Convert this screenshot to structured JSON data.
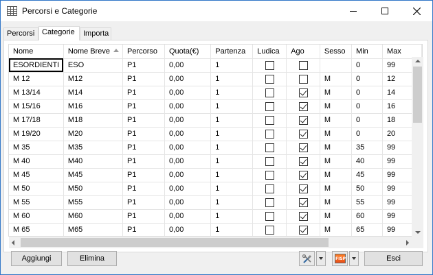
{
  "window": {
    "title": "Percorsi e Categorie"
  },
  "tabs": [
    {
      "label": "Percorsi"
    },
    {
      "label": "Categorie"
    },
    {
      "label": "Importa"
    }
  ],
  "grid": {
    "columns": [
      "Nome",
      "Nome Breve",
      "Percorso",
      "Quota(€)",
      "Partenza",
      "Ludica",
      "Ago",
      "Sesso",
      "Min",
      "Max"
    ],
    "sorted_column": "Nome Breve",
    "rows": [
      {
        "nome": "ESORDIENTI",
        "breve": "ESO",
        "percorso": "P1",
        "quota": "0,00",
        "partenza": "1",
        "ludica": false,
        "ago": false,
        "sesso": "",
        "min": "0",
        "max": "99"
      },
      {
        "nome": "M 12",
        "breve": "M12",
        "percorso": "P1",
        "quota": "0,00",
        "partenza": "1",
        "ludica": false,
        "ago": false,
        "sesso": "M",
        "min": "0",
        "max": "12"
      },
      {
        "nome": "M 13/14",
        "breve": "M14",
        "percorso": "P1",
        "quota": "0,00",
        "partenza": "1",
        "ludica": false,
        "ago": true,
        "sesso": "M",
        "min": "0",
        "max": "14"
      },
      {
        "nome": "M 15/16",
        "breve": "M16",
        "percorso": "P1",
        "quota": "0,00",
        "partenza": "1",
        "ludica": false,
        "ago": true,
        "sesso": "M",
        "min": "0",
        "max": "16"
      },
      {
        "nome": "M 17/18",
        "breve": "M18",
        "percorso": "P1",
        "quota": "0,00",
        "partenza": "1",
        "ludica": false,
        "ago": true,
        "sesso": "M",
        "min": "0",
        "max": "18"
      },
      {
        "nome": "M 19/20",
        "breve": "M20",
        "percorso": "P1",
        "quota": "0,00",
        "partenza": "1",
        "ludica": false,
        "ago": true,
        "sesso": "M",
        "min": "0",
        "max": "20"
      },
      {
        "nome": "M 35",
        "breve": "M35",
        "percorso": "P1",
        "quota": "0,00",
        "partenza": "1",
        "ludica": false,
        "ago": true,
        "sesso": "M",
        "min": "35",
        "max": "99"
      },
      {
        "nome": "M 40",
        "breve": "M40",
        "percorso": "P1",
        "quota": "0,00",
        "partenza": "1",
        "ludica": false,
        "ago": true,
        "sesso": "M",
        "min": "40",
        "max": "99"
      },
      {
        "nome": "M 45",
        "breve": "M45",
        "percorso": "P1",
        "quota": "0,00",
        "partenza": "1",
        "ludica": false,
        "ago": true,
        "sesso": "M",
        "min": "45",
        "max": "99"
      },
      {
        "nome": "M 50",
        "breve": "M50",
        "percorso": "P1",
        "quota": "0,00",
        "partenza": "1",
        "ludica": false,
        "ago": true,
        "sesso": "M",
        "min": "50",
        "max": "99"
      },
      {
        "nome": "M 55",
        "breve": "M55",
        "percorso": "P1",
        "quota": "0,00",
        "partenza": "1",
        "ludica": false,
        "ago": true,
        "sesso": "M",
        "min": "55",
        "max": "99"
      },
      {
        "nome": "M 60",
        "breve": "M60",
        "percorso": "P1",
        "quota": "0,00",
        "partenza": "1",
        "ludica": false,
        "ago": true,
        "sesso": "M",
        "min": "60",
        "max": "99"
      },
      {
        "nome": "M 65",
        "breve": "M65",
        "percorso": "P1",
        "quota": "0,00",
        "partenza": "1",
        "ludica": false,
        "ago": true,
        "sesso": "M",
        "min": "65",
        "max": "99"
      }
    ]
  },
  "buttons": {
    "add": "Aggiungi",
    "delete": "Elimina",
    "exit": "Esci",
    "tools_icon": "tools-icon",
    "fisp_icon": "fisp-logo-icon",
    "fisp_text": "FISP"
  },
  "colors": {
    "window_border": "#2f75c7",
    "fisp_orange": "#ff7f27"
  }
}
